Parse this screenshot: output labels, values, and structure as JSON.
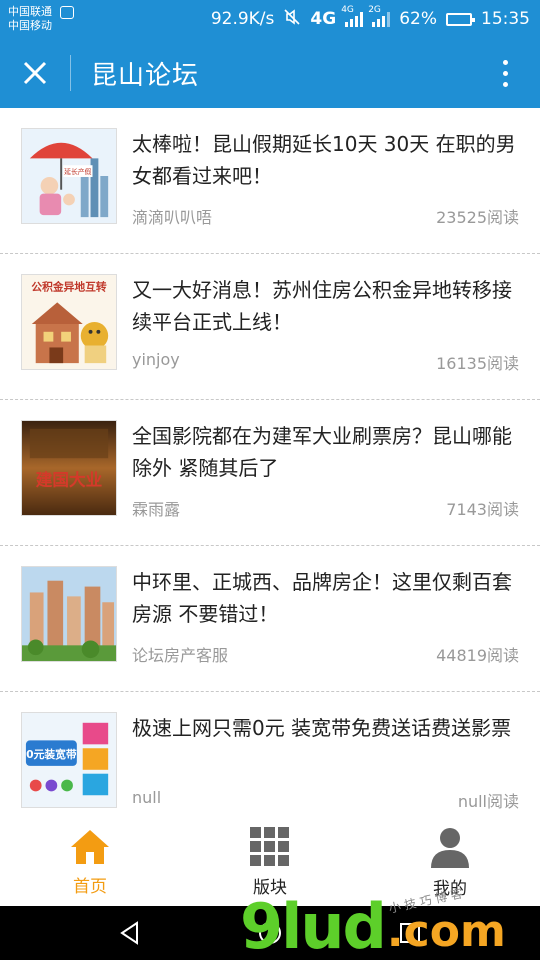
{
  "status_bar": {
    "carrier_1": "中国联通",
    "carrier_2": "中国移动",
    "net_speed": "92.9K/s",
    "network_1": "4G",
    "network_2": "4G",
    "network_3": "2G",
    "battery_percent": "62%",
    "battery_level": 0.62,
    "time": "15:35"
  },
  "header": {
    "title": "昆山论坛",
    "close_icon": "close-icon",
    "more_icon": "more-vertical-icon"
  },
  "feed": {
    "items": [
      {
        "title": "太棒啦！昆山假期延长10天 30天 在职的男女都看过来吧！",
        "author": "滴滴叭叭唔",
        "reads": "23525阅读"
      },
      {
        "title": "又一大好消息！苏州住房公积金异地转移接续平台正式上线！",
        "author": "yinjoy",
        "reads": "16135阅读"
      },
      {
        "title": "全国影院都在为建军大业刷票房？昆山哪能除外 紧随其后了",
        "author": "霖雨露",
        "reads": "7143阅读"
      },
      {
        "title": "中环里、正城西、品牌房企！这里仅剩百套房源 不要错过！",
        "author": "论坛房产客服",
        "reads": "44819阅读"
      },
      {
        "title": "极速上网只需0元 装宽带免费送话费送影票",
        "author": "null",
        "reads": "null阅读"
      }
    ]
  },
  "thumbs": {
    "t1_text": "延长产假",
    "t2_text": "公积金异地互转",
    "t3_text": "建国大业",
    "t5_text": "0元装宽带"
  },
  "tabbar": {
    "tabs": [
      {
        "label": "首页",
        "icon": "home-icon",
        "active": true
      },
      {
        "label": "版块",
        "icon": "grid-icon",
        "active": false
      },
      {
        "label": "我的",
        "icon": "user-icon",
        "active": false
      }
    ]
  },
  "watermark": {
    "main": "9lud",
    "suffix": ".com",
    "small": "小 技 巧 博 客"
  },
  "colors": {
    "primary": "#1f8fd4",
    "active_tab": "#f39c12",
    "watermark_green": "#5dcf2a",
    "watermark_orange": "#f5a623"
  }
}
